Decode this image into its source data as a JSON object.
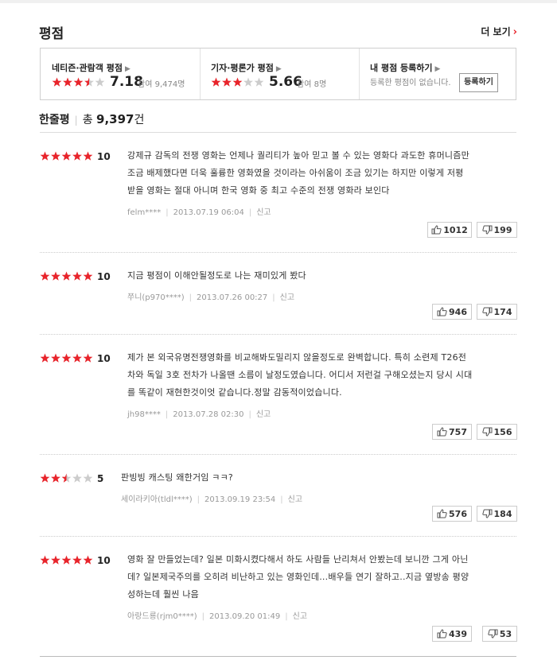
{
  "section_title": "평점",
  "more_label": "더 보기",
  "ratings": {
    "netizen": {
      "label": "네티즌·관람객 평점",
      "score": "7.18",
      "participants": "참여 9,474명",
      "stars": 3.5
    },
    "critic": {
      "label": "기자·평론가 평점",
      "score": "5.66",
      "participants": "참여 8명",
      "stars": 3
    },
    "mine": {
      "label": "내 평점 등록하기",
      "empty_text": "등록한 평점이 없습니다.",
      "register_label": "등록하기"
    }
  },
  "comments_header": {
    "label": "한줄평",
    "total_prefix": "총",
    "total": "9,397",
    "unit": "건"
  },
  "reviews": [
    {
      "stars": 5,
      "score": "10",
      "lines": [
        "강제규 감독의 전쟁 영화는 언제나 퀄리티가 높아 믿고 볼 수 있는 영화다 과도한 휴머니즘만",
        "조금 배제했다면 더욱 훌륭한 영화였을 것이라는 아쉬움이 조금 있기는 하지만 이렇게 저평",
        "받을 영화는 절대 아니며 한국 영화 중 최고 수준의 전쟁 영화라 보인다"
      ],
      "author": "felm****",
      "date": "2013.07.19 06:04",
      "report": "신고",
      "likes": "1012",
      "dislikes": "199"
    },
    {
      "stars": 5,
      "score": "10",
      "lines": [
        "지금 평점이 이해안될정도로 나는 재미있게 봤다"
      ],
      "author": "쭈니(p970****)",
      "date": "2013.07.26 00:27",
      "report": "신고",
      "likes": "946",
      "dislikes": "174"
    },
    {
      "stars": 5,
      "score": "10",
      "lines": [
        "제가 본 외국유명전쟁영화를 비교해봐도밀리지 않을정도로 완벽합니다. 특히 소련제 T26전",
        "차와 독일 3호 전차가 나올땐 소름이 날정도였습니다. 어디서 저런걸 구해오셨는지 당시 시대",
        "를 똑같이 재현한것이엇 같습니다.정말 감동적이었습니다."
      ],
      "author": "jh98****",
      "date": "2013.07.28 02:30",
      "report": "신고",
      "likes": "757",
      "dislikes": "156"
    },
    {
      "stars": 2.5,
      "score": "5",
      "lines": [
        "판빙빙 캐스팅 왜한거임 ㅋㅋ?"
      ],
      "author": "세이라키아(tldl****)",
      "date": "2013.09.19 23:54",
      "report": "신고",
      "likes": "576",
      "dislikes": "184"
    },
    {
      "stars": 5,
      "score": "10",
      "lines": [
        "영화 잘 만들었는데? 일본 미화시켰다해서 하도 사람들 난리쳐서 안봤는데 보니깐 그게 아닌",
        "데? 일본제국주의를 오히려 비난하고 있는 영화인데...배우들 연기 잘하고..지금 옆방송 평양",
        "성하는데 훨씬 나음"
      ],
      "author": "아랑드룡(rjm0****)",
      "date": "2013.09.20 01:49",
      "report": "신고",
      "likes": "439",
      "dislikes": "53"
    }
  ],
  "colors": {
    "star_on": "#e8242b",
    "star_off": "#cccccc",
    "chevron": "#e8242b"
  },
  "icons": {
    "like": "thumbs-up-icon",
    "dislike": "thumbs-down-icon",
    "arrow": "chevron-right-icon"
  }
}
